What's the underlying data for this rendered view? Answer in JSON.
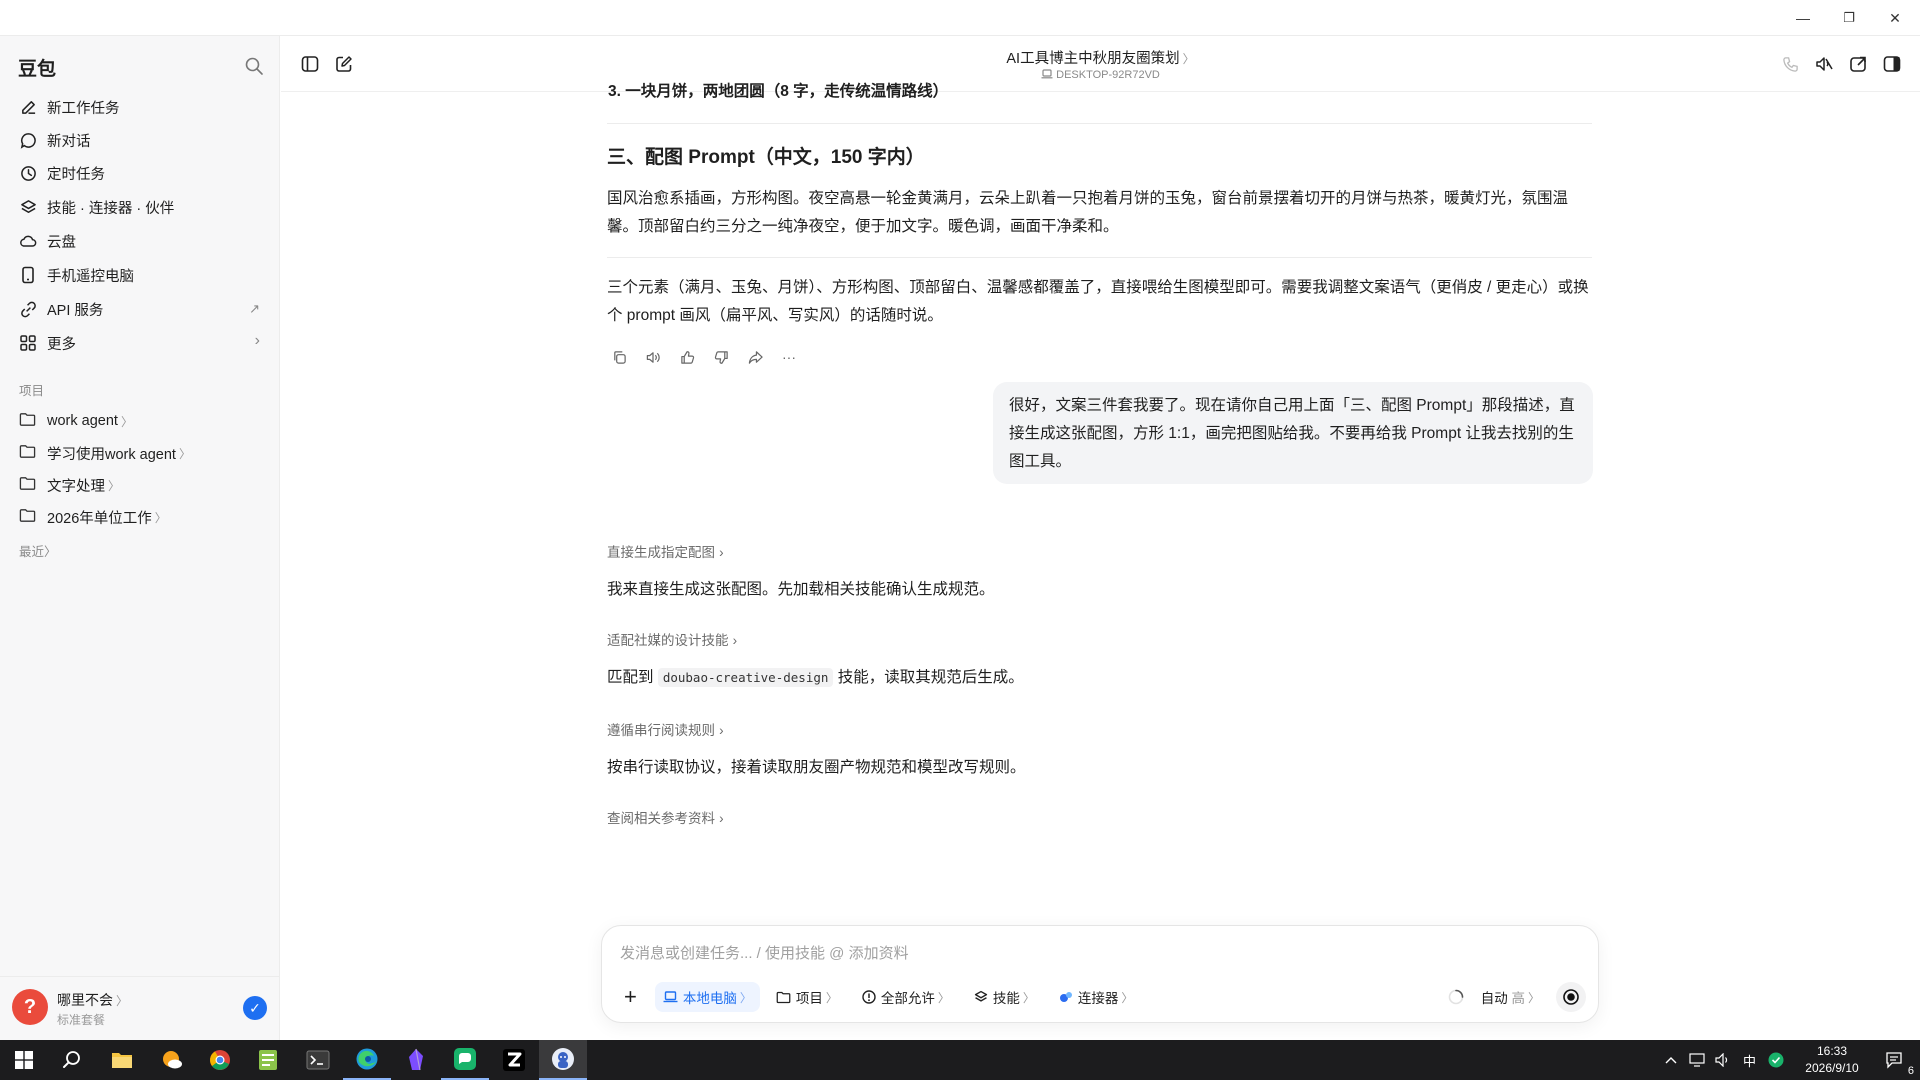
{
  "window": {
    "minimize": "—",
    "maximize": "❐",
    "close": "✕"
  },
  "sidebar": {
    "brand": "豆包",
    "nav": [
      {
        "label": "新工作任务",
        "icon": "edit-icon"
      },
      {
        "label": "新对话",
        "icon": "chat-bubble-icon"
      },
      {
        "label": "定时任务",
        "icon": "clock-icon"
      },
      {
        "label": "技能 · 连接器 · 伙伴",
        "icon": "layers-icon"
      },
      {
        "label": "云盘",
        "icon": "cloud-icon"
      },
      {
        "label": "手机遥控电脑",
        "icon": "phone-icon"
      },
      {
        "label": "API 服务",
        "icon": "api-icon",
        "tail": "↗"
      },
      {
        "label": "更多",
        "icon": "grid-icon",
        "tail": "›"
      }
    ],
    "projects_label": "项目",
    "projects": [
      {
        "label": "work agent",
        "chev": "〉"
      },
      {
        "label": "学习使用work agent",
        "chev": "〉"
      },
      {
        "label": "文字处理",
        "chev": "〉"
      },
      {
        "label": "2026年单位工作",
        "chev": "〉"
      }
    ],
    "recent_label": "最近",
    "recent_chev": "〉",
    "user": {
      "avatar": "?",
      "name": "哪里不会",
      "name_chev": "〉",
      "plan": "标准套餐",
      "check": "✓"
    }
  },
  "header": {
    "title": "AI工具博主中秋朋友圈策划",
    "title_chev": "〉",
    "subtitle": "DESKTOP-92R72VD"
  },
  "message": {
    "partial_line": "3. 一块月饼，两地团圆（8 字，走传统温情路线）",
    "heading": "三、配图 Prompt（中文，150 字内）",
    "prompt_text": "国风治愈系插画，方形构图。夜空高悬一轮金黄满月，云朵上趴着一只抱着月饼的玉兔，窗台前景摆着切开的月饼与热茶，暖黄灯光，氛围温馨。顶部留白约三分之一纯净夜空，便于加文字。暖色调，画面干净柔和。",
    "summary": "三个元素（满月、玉兔、月饼）、方形构图、顶部留白、温馨感都覆盖了，直接喂给生图模型即可。需要我调整文案语气（更俏皮 / 更走心）或换个 prompt 画风（扁平风、写实风）的话随时说。",
    "more_icon": "···"
  },
  "user_message": "很好，文案三件套我要了。现在请你自己用上面「三、配图 Prompt」那段描述，直接生成这张配图，方形 1:1，画完把图贴给我。不要再给我 Prompt 让我去找别的生图工具。",
  "steps": [
    {
      "link": "直接生成指定配图",
      "text": "我来直接生成这张配图。先加载相关技能确认生成规范。"
    },
    {
      "link": "适配社媒的设计技能",
      "text_before": "匹配到",
      "code": "doubao-creative-design",
      "text_after": "技能，读取其规范后生成。"
    },
    {
      "link": "遵循串行阅读规则",
      "text": "按串行读取协议，接着读取朋友圈产物规范和模型改写规则。"
    },
    {
      "link": "查阅相关参考资料"
    }
  ],
  "step_chev": "›",
  "composer": {
    "placeholder": "发消息或创建任务... / 使用技能 @ 添加资料",
    "add": "+",
    "chips": [
      {
        "label": "本地电脑",
        "chev": "〉"
      },
      {
        "label": "项目",
        "chev": "〉"
      },
      {
        "label": "全部允许",
        "chev": "〉"
      },
      {
        "label": "技能",
        "chev": "〉"
      },
      {
        "label": "连接器",
        "chev": "〉"
      }
    ],
    "mode": "自动",
    "level": "高",
    "level_chev": "〉"
  },
  "taskbar": {
    "ime": "中",
    "time": "16:33",
    "date": "2026/9/10",
    "notif_count": "6"
  },
  "colors": {
    "accent": "#1e6ff1",
    "sidebar_bg": "#f7f7f8",
    "bubble_bg": "#f3f4f6",
    "taskbar_bg": "#1c1c1e"
  }
}
